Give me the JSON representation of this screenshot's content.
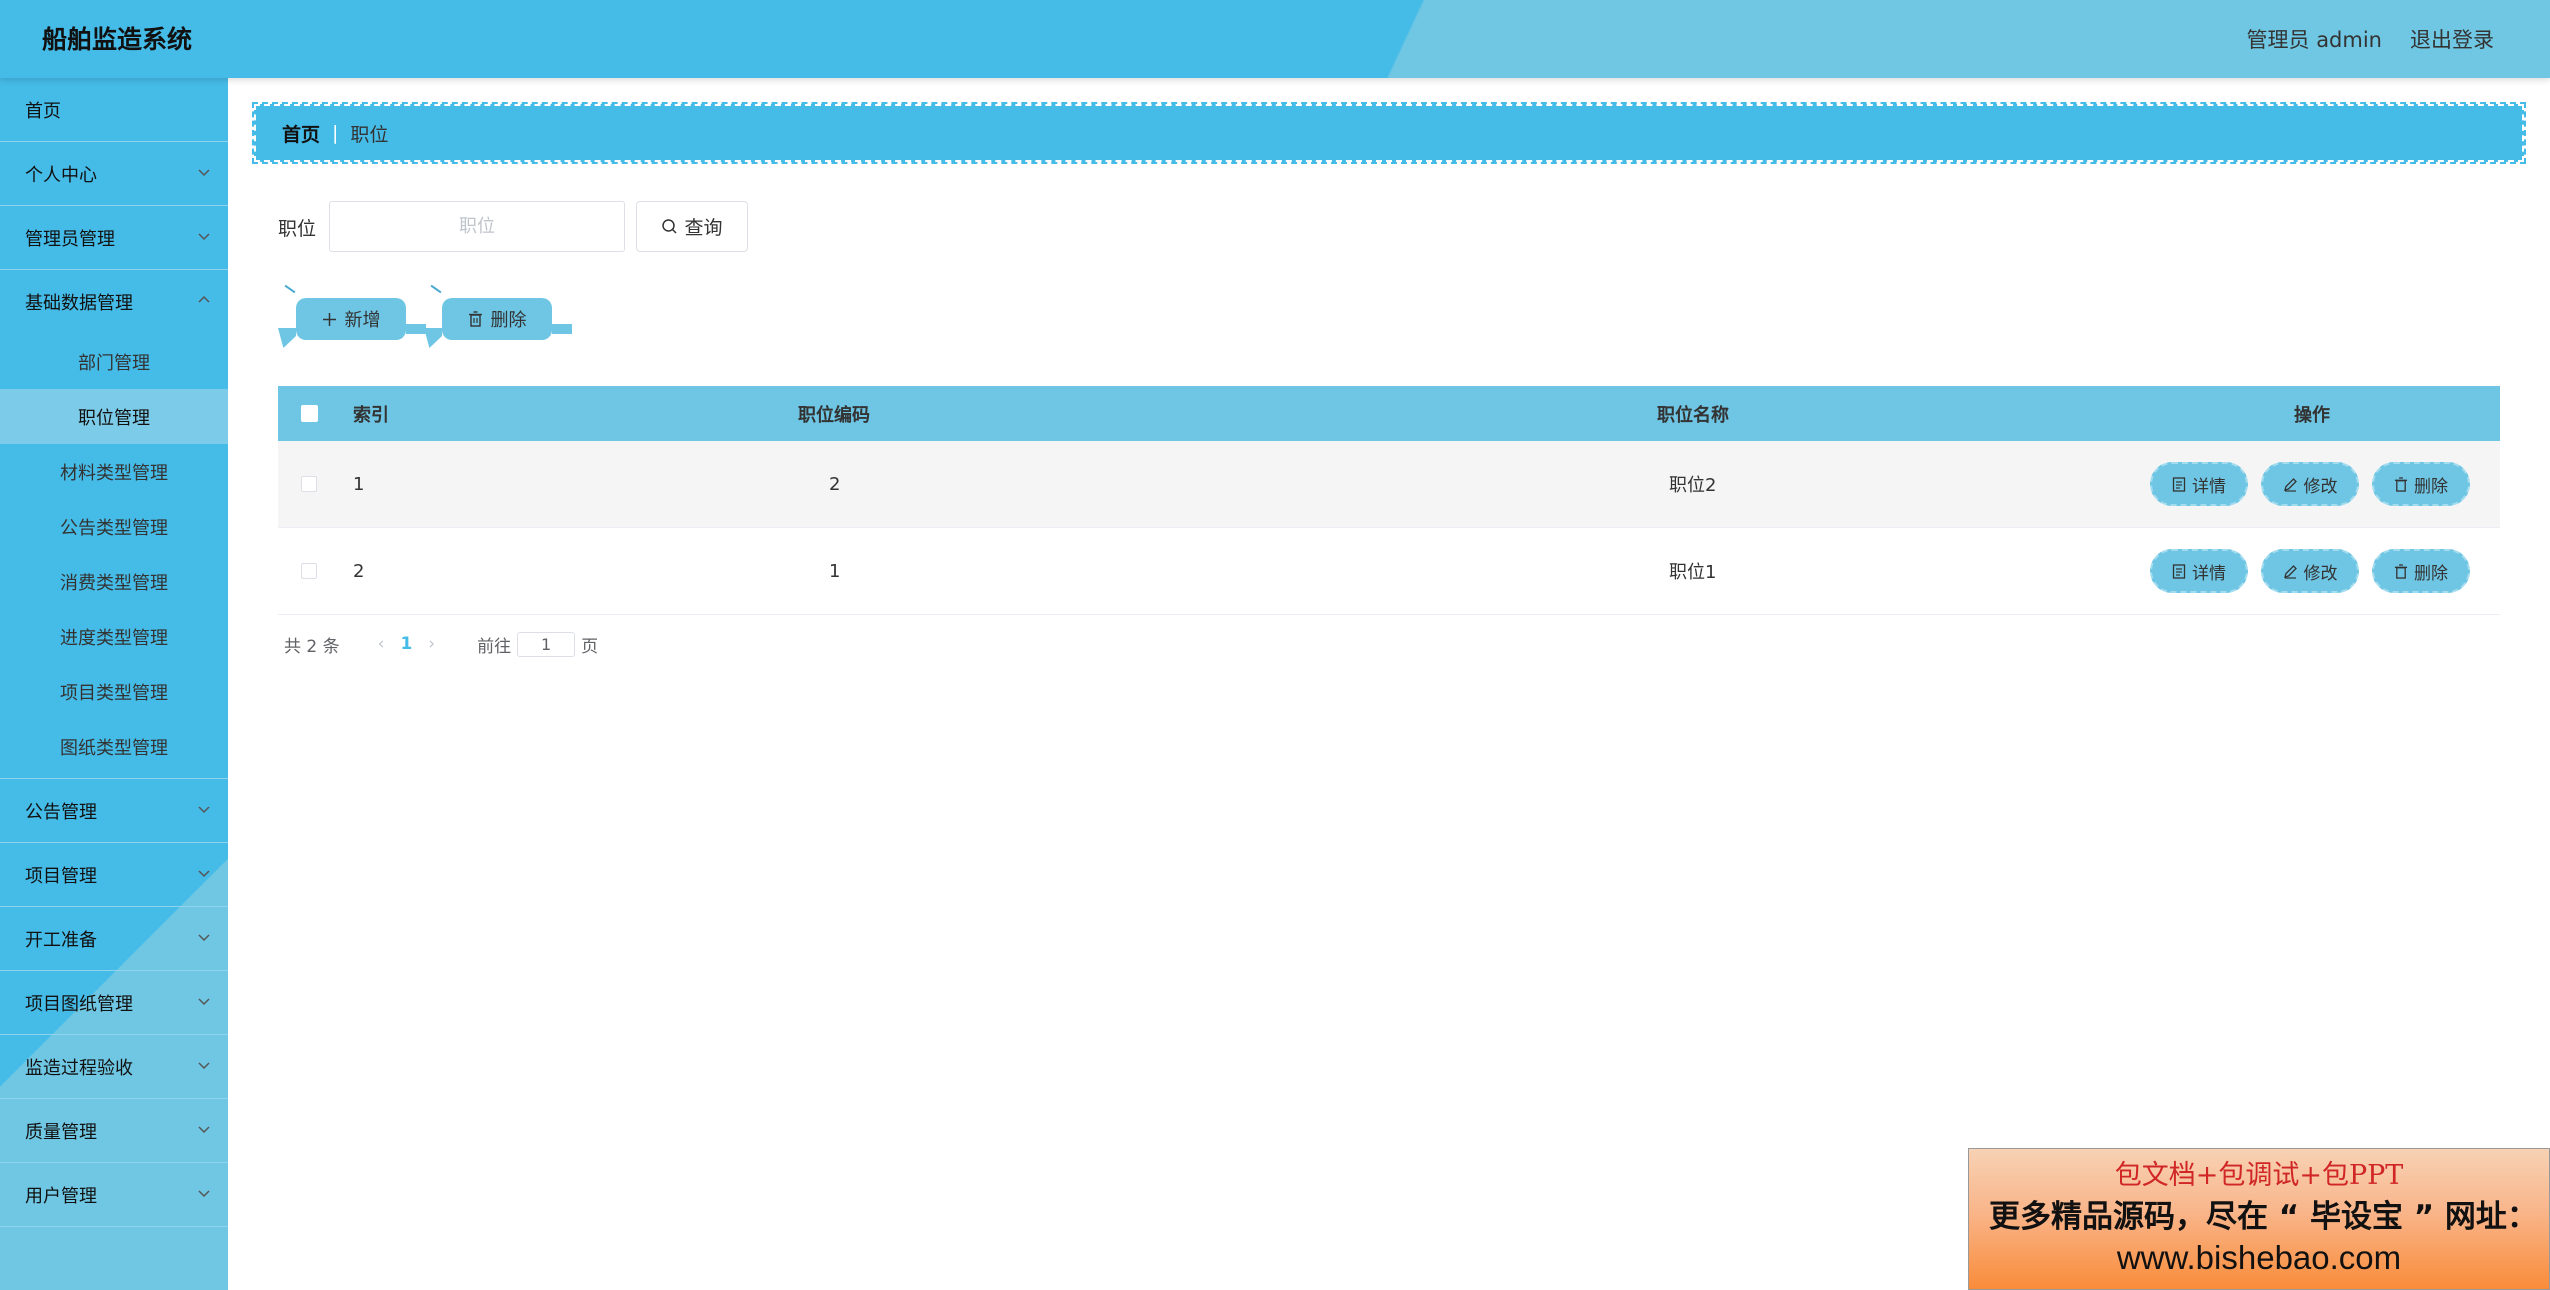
{
  "header": {
    "title": "船舶监造系统",
    "user": "管理员 admin",
    "logout": "退出登录"
  },
  "sidebar": {
    "items": [
      {
        "label": "首页"
      },
      {
        "label": "个人中心"
      },
      {
        "label": "管理员管理"
      },
      {
        "label": "基础数据管理",
        "children": [
          "部门管理",
          "职位管理",
          "材料类型管理",
          "公告类型管理",
          "消费类型管理",
          "进度类型管理",
          "项目类型管理",
          "图纸类型管理"
        ]
      },
      {
        "label": "公告管理"
      },
      {
        "label": "项目管理"
      },
      {
        "label": "开工准备"
      },
      {
        "label": "项目图纸管理"
      },
      {
        "label": "监造过程验收"
      },
      {
        "label": "质量管理"
      },
      {
        "label": "用户管理"
      }
    ],
    "active_child": "职位管理"
  },
  "breadcrumb": {
    "home": "首页",
    "current": "职位"
  },
  "search": {
    "label": "职位",
    "placeholder": "职位",
    "value": "",
    "button": "查询"
  },
  "actions": {
    "add": "新增",
    "delete": "删除"
  },
  "table": {
    "columns": [
      "索引",
      "职位编码",
      "职位名称",
      "操作"
    ],
    "rows": [
      {
        "index": "1",
        "code": "2",
        "name": "职位2"
      },
      {
        "index": "2",
        "code": "1",
        "name": "职位1"
      }
    ],
    "row_actions": {
      "detail": "详情",
      "edit": "修改",
      "delete": "删除"
    }
  },
  "pagination": {
    "total": "共 2 条",
    "current": "1",
    "goto": "前往",
    "jump_value": "1",
    "page_unit": "页"
  },
  "banner": {
    "line1": "包文档+包调试+包PPT",
    "line2": "更多精品源码，尽在 “ 毕设宝 ” 网址：",
    "line3": "www.bishebao.com"
  },
  "colors": {
    "primary": "#45bbe7",
    "secondary": "#70c7e3",
    "button": "#6ec6e4"
  },
  "icons": [
    "chevron-down-icon",
    "search-icon",
    "plus-icon",
    "trash-icon",
    "document-icon",
    "edit-icon"
  ]
}
